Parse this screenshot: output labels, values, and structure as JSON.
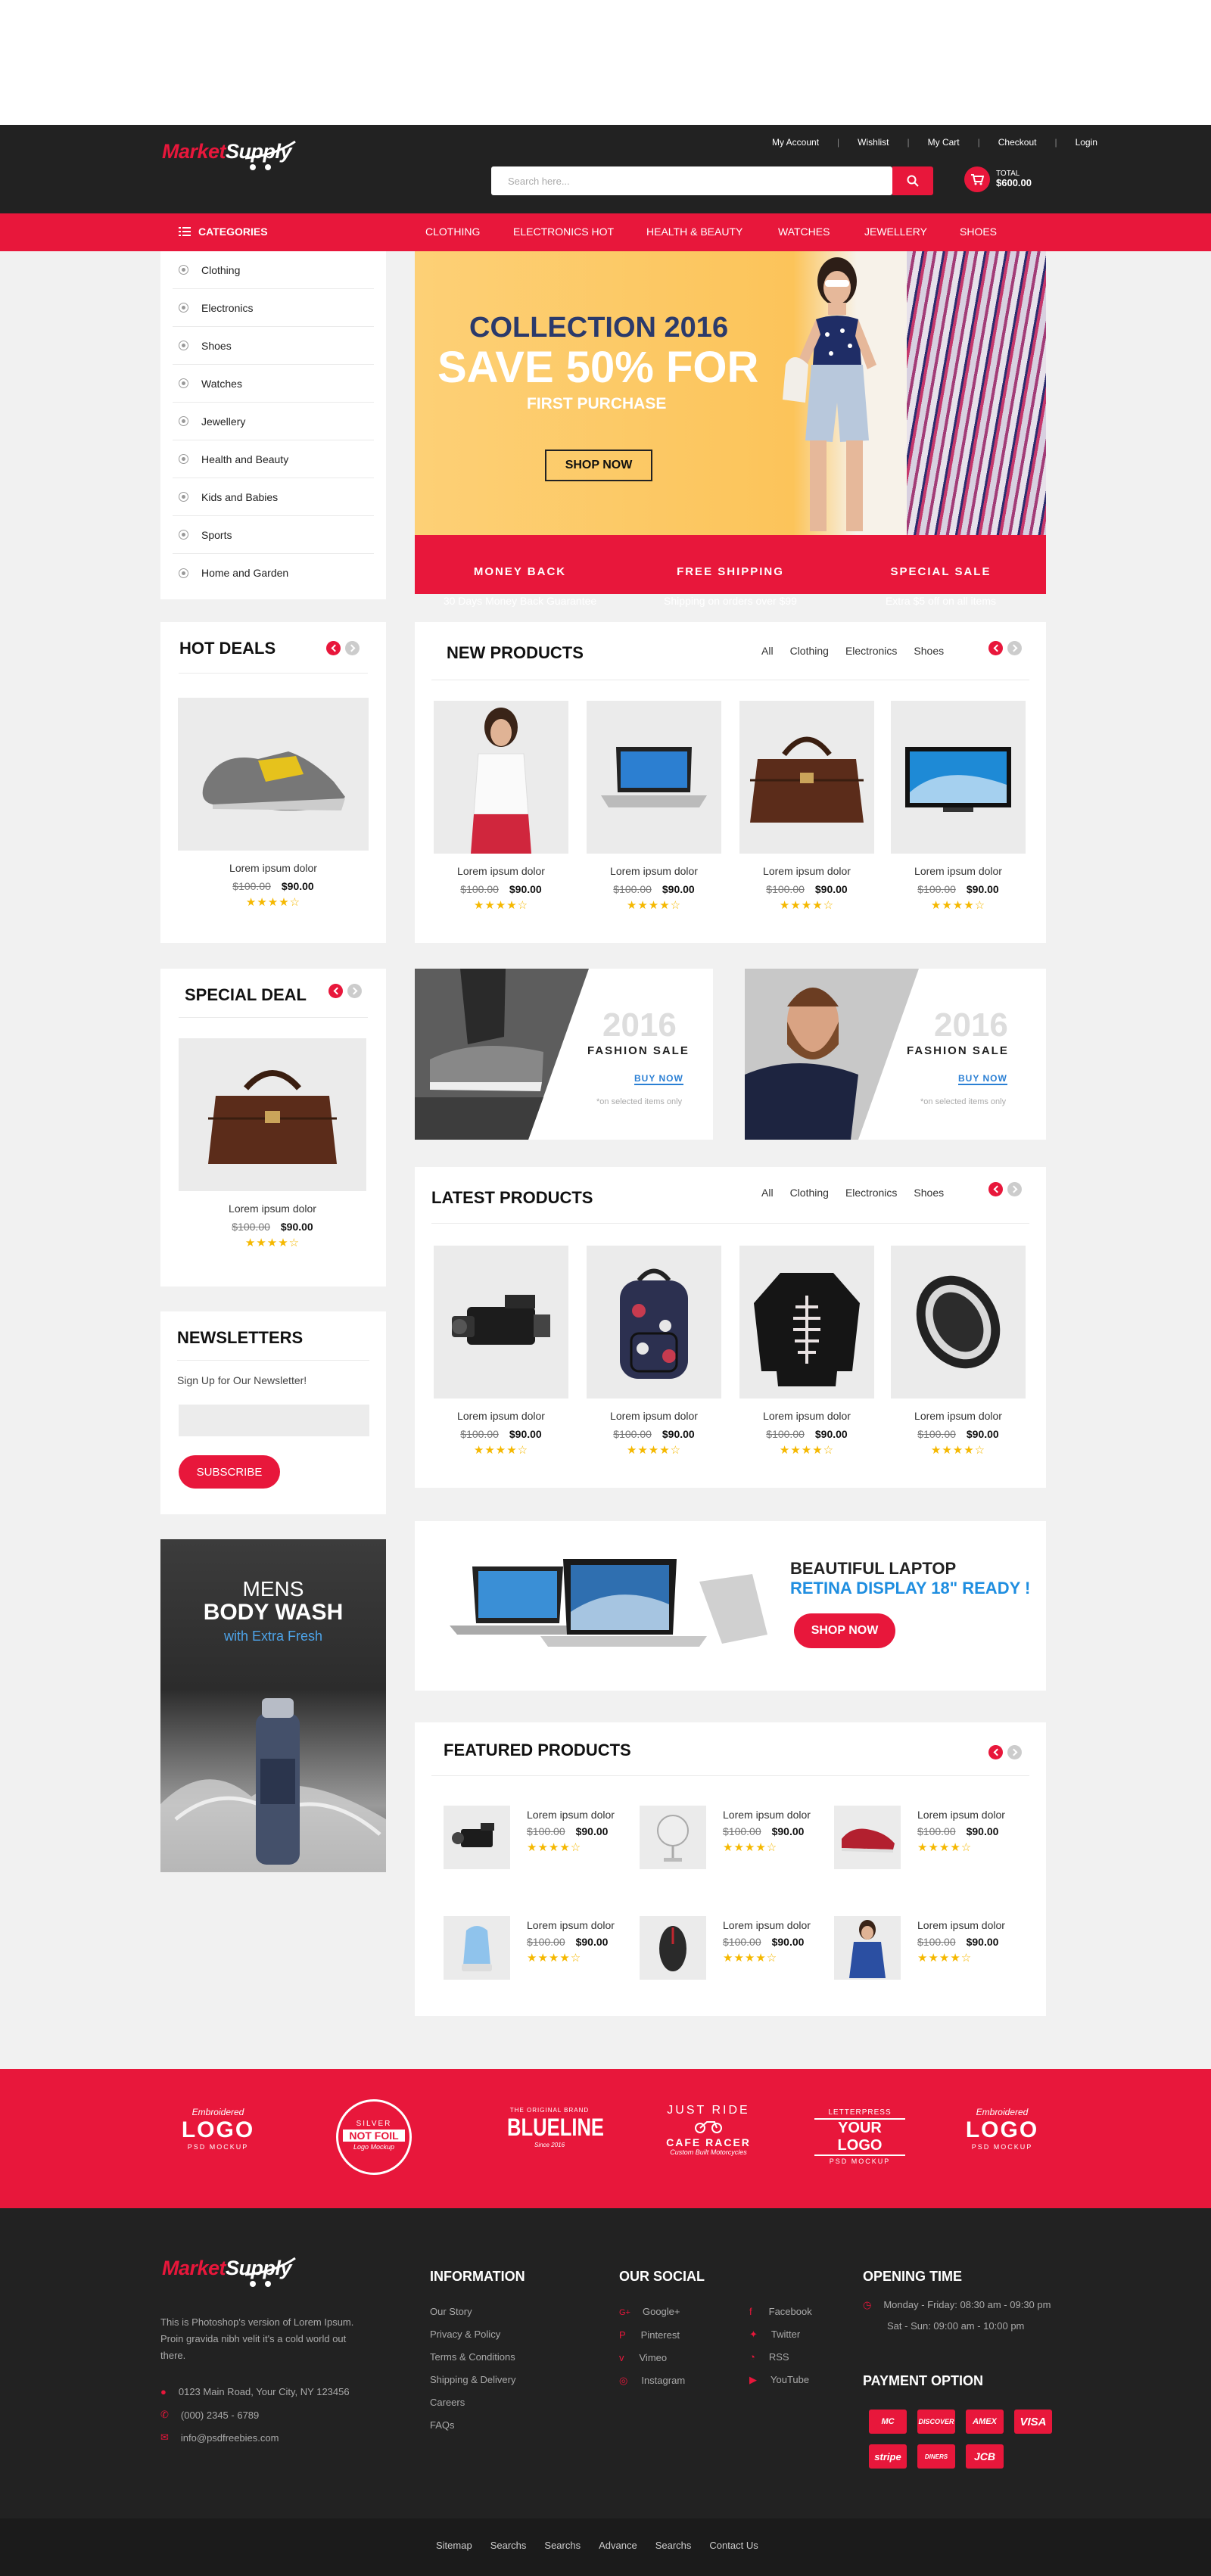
{
  "header": {
    "logo_a": "Market",
    "logo_b": "Supply",
    "links": [
      "My Account",
      "Wishlist",
      "My Cart",
      "Checkout",
      "Login"
    ],
    "search_placeholder": "Search here...",
    "cart_total_label": "TOTAL",
    "cart_total": "$600.00"
  },
  "nav": {
    "categories_label": "CATEGORIES",
    "items": [
      "CLOTHING",
      "ELECTRONICS HOT",
      "HEALTH & BEAUTY",
      "WATCHES",
      "JEWELLERY",
      "SHOES"
    ]
  },
  "sidebar_categories": [
    "Clothing",
    "Electronics",
    "Shoes",
    "Watches",
    "Jewellery",
    "Health and Beauty",
    "Kids and Babies",
    "Sports",
    "Home and Garden"
  ],
  "banner": {
    "line1": "COLLECTION 2016",
    "line2": "SAVE 50% FOR",
    "line3": "FIRST PURCHASE",
    "button": "SHOP NOW",
    "features": [
      {
        "title": "MONEY BACK",
        "sub": "30 Days Money Back Guarantee"
      },
      {
        "title": "FREE SHIPPING",
        "sub": "Shipping on orders over $99"
      },
      {
        "title": "SPECIAL SALE",
        "sub": "Extra $5 off on all items"
      }
    ]
  },
  "hot_deals": {
    "title": "HOT DEALS",
    "name": "Lorem ipsum dolor",
    "old": "$100.00",
    "price": "$90.00"
  },
  "special_deal": {
    "title": "SPECIAL DEAL",
    "name": "Lorem ipsum dolor",
    "old": "$100.00",
    "price": "$90.00"
  },
  "newsletter": {
    "title": "NEWSLETTERS",
    "text": "Sign Up for Our Newsletter!",
    "button": "SUBSCRIBE"
  },
  "bodywash": {
    "l1": "MENS",
    "l2": "BODY WASH",
    "l3": "with Extra Fresh"
  },
  "filters": [
    "All",
    "Clothing",
    "Electronics",
    "Shoes"
  ],
  "new_products": {
    "title": "NEW PRODUCTS",
    "items": [
      {
        "name": "Lorem ipsum dolor",
        "old": "$100.00",
        "price": "$90.00",
        "icon": "woman-top-icon"
      },
      {
        "name": "Lorem ipsum dolor",
        "old": "$100.00",
        "price": "$90.00",
        "icon": "laptop-icon"
      },
      {
        "name": "Lorem ipsum dolor",
        "old": "$100.00",
        "price": "$90.00",
        "icon": "bag-icon"
      },
      {
        "name": "Lorem ipsum dolor",
        "old": "$100.00",
        "price": "$90.00",
        "icon": "tv-icon"
      }
    ]
  },
  "fashion_sale": {
    "year": "2016",
    "title": "FASHION SALE",
    "cta": "BUY NOW",
    "note": "*on selected items only"
  },
  "latest_products": {
    "title": "LATEST PRODUCTS",
    "items": [
      {
        "name": "Lorem ipsum dolor",
        "old": "$100.00",
        "price": "$90.00",
        "icon": "camcorder-icon"
      },
      {
        "name": "Lorem ipsum dolor",
        "old": "$100.00",
        "price": "$90.00",
        "icon": "backpack-icon"
      },
      {
        "name": "Lorem ipsum dolor",
        "old": "$100.00",
        "price": "$90.00",
        "icon": "sweater-icon"
      },
      {
        "name": "Lorem ipsum dolor",
        "old": "$100.00",
        "price": "$90.00",
        "icon": "mouse-icon"
      }
    ]
  },
  "laptop_promo": {
    "l1": "BEAUTIFUL LAPTOP",
    "l2": "RETINA DISPLAY 18\" READY !",
    "button": "SHOP NOW"
  },
  "featured": {
    "title": "FEATURED PRODUCTS",
    "items": [
      {
        "name": "Lorem ipsum dolor",
        "old": "$100.00",
        "price": "$90.00"
      },
      {
        "name": "Lorem ipsum dolor",
        "old": "$100.00",
        "price": "$90.00"
      },
      {
        "name": "Lorem ipsum dolor",
        "old": "$100.00",
        "price": "$90.00"
      },
      {
        "name": "Lorem ipsum dolor",
        "old": "$100.00",
        "price": "$90.00"
      },
      {
        "name": "Lorem ipsum dolor",
        "old": "$100.00",
        "price": "$90.00"
      },
      {
        "name": "Lorem ipsum dolor",
        "old": "$100.00",
        "price": "$90.00"
      }
    ]
  },
  "brand_logos": [
    {
      "top": "Embroidered",
      "main": "LOGO",
      "sub": "PSD MOCKUP"
    },
    {
      "top": "SILVER",
      "main": "NOT FOIL",
      "sub": "Logo Mockup"
    },
    {
      "top": "THE ORIGINAL BRAND",
      "main": "BLUELINE",
      "sub": "Since 2016"
    },
    {
      "top": "JUST RIDE",
      "main": "CAFE RACER",
      "sub": "Custom Built Motorcycles"
    },
    {
      "top": "LETTERPRESS",
      "main": "YOUR LOGO",
      "sub": "PSD MOCKUP"
    },
    {
      "top": "Embroidered",
      "main": "LOGO",
      "sub": "PSD MOCKUP"
    }
  ],
  "footer": {
    "about": "This is Photoshop's version of Lorem Ipsum. Proin gravida nibh velit it's a cold world out there.",
    "address": "0123 Main Road, Your City, NY 123456",
    "phone": "(000) 2345 - 6789",
    "email": "info@psdfreebies.com",
    "info_title": "INFORMATION",
    "info_links": [
      "Our Story",
      "Privacy & Policy",
      "Terms & Conditions",
      "Shipping & Delivery",
      "Careers",
      "FAQs"
    ],
    "social_title": "OUR SOCIAL",
    "social_col1": [
      "Google+",
      "Pinterest",
      "Vimeo",
      "Instagram"
    ],
    "social_col2": [
      "Facebook",
      "Twitter",
      "RSS",
      "YouTube"
    ],
    "opening_title": "OPENING TIME",
    "opening1": "Monday - Friday: 08:30 am - 09:30 pm",
    "opening2": "Sat - Sun: 09:00 am - 10:00 pm",
    "payment_title": "PAYMENT OPTION",
    "payments": [
      "MC",
      "DISCOVER",
      "AMEX",
      "VISA",
      "stripe",
      "DINERS",
      "JCB"
    ],
    "bottom_links": [
      "Sitemap",
      "Searchs",
      "Searchs",
      "Advance",
      "Searchs",
      "Contact Us"
    ]
  },
  "colors": {
    "accent": "#e8173b",
    "dark": "#222222"
  }
}
